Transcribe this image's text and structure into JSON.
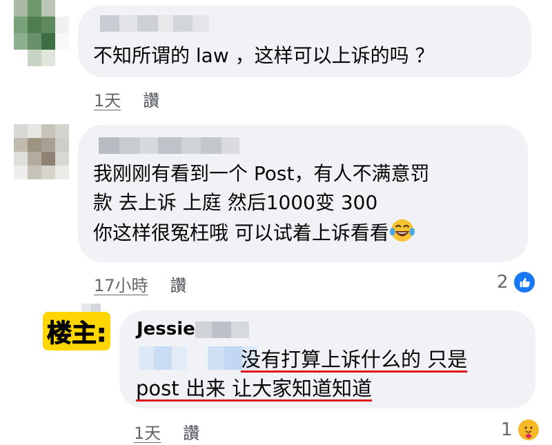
{
  "comments": [
    {
      "text_lines": [
        "不知所谓的 law ，这样可以上诉的吗 ？"
      ],
      "time": "1天",
      "like_label": "讚"
    },
    {
      "text_lines": [
        "我刚刚有看到一个 Post，有人不满意罚",
        "款  去上诉  上庭  然后1000变 300",
        "你这样很冤枉哦  可以试着上诉看看"
      ],
      "time": "17小時",
      "like_label": "讚",
      "reaction_count": "2",
      "reaction_icon": "like-icon"
    },
    {
      "tag": "楼主:",
      "name": "Jessie",
      "text_lines": [
        "没有打算上诉什么的 只是",
        "post 出来 让大家知道知道"
      ],
      "time": "1天",
      "like_label": "讚",
      "reaction_count": "1",
      "reaction_icon": "care-icon"
    }
  ],
  "colors": {
    "bubble": "#f0f2f5",
    "meta_text": "#65676b",
    "like_blue": "#1877f2",
    "highlight_yellow": "#ffd600",
    "underline_red": "#e0121b"
  }
}
